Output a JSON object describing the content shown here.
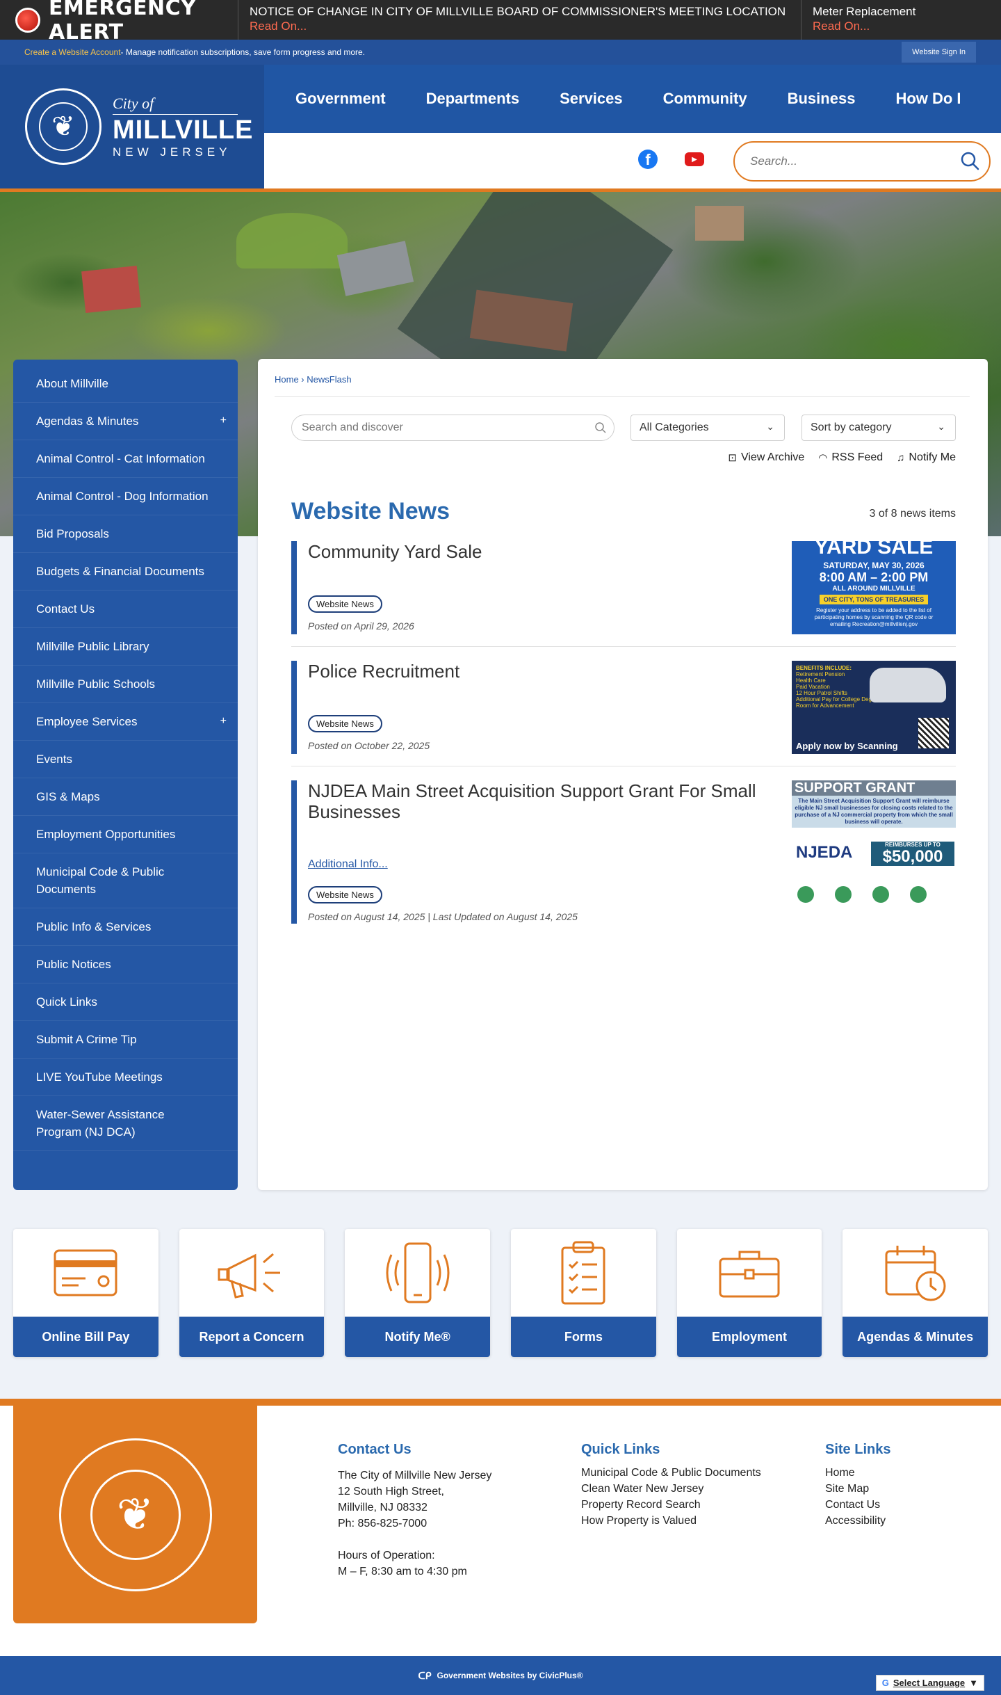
{
  "alert": {
    "title": "EMERGENCY ALERT",
    "items": [
      {
        "headline": "NOTICE OF CHANGE IN CITY OF MILLVILLE BOARD OF COMMISSIONER'S MEETING LOCATION",
        "link": "Read On..."
      },
      {
        "headline": "Meter Replacement",
        "link": "Read On..."
      }
    ]
  },
  "account": {
    "create_link": "Create a Website Account",
    "text": " - Manage notification subscriptions, save form progress and more.",
    "signin": "Website Sign In"
  },
  "logo": {
    "city_of": "City of",
    "name": "MILLVILLE",
    "state": "NEW JERSEY"
  },
  "nav": [
    "Government",
    "Departments",
    "Services",
    "Community",
    "Business",
    "How Do I"
  ],
  "header_search": {
    "placeholder": "Search..."
  },
  "sidebar": [
    {
      "label": "About Millville",
      "expand": ""
    },
    {
      "label": "Agendas & Minutes",
      "expand": "+"
    },
    {
      "label": "Animal Control - Cat Information",
      "expand": ""
    },
    {
      "label": "Animal Control - Dog Information",
      "expand": ""
    },
    {
      "label": "Bid Proposals",
      "expand": ""
    },
    {
      "label": "Budgets & Financial Documents",
      "expand": ""
    },
    {
      "label": "Contact Us",
      "expand": ""
    },
    {
      "label": "Millville Public Library",
      "expand": ""
    },
    {
      "label": "Millville Public Schools",
      "expand": ""
    },
    {
      "label": "Employee Services",
      "expand": "+"
    },
    {
      "label": "Events",
      "expand": ""
    },
    {
      "label": "GIS & Maps",
      "expand": ""
    },
    {
      "label": "Employment Opportunities",
      "expand": ""
    },
    {
      "label": "Municipal Code & Public Documents",
      "expand": ""
    },
    {
      "label": "Public Info & Services",
      "expand": ""
    },
    {
      "label": "Public Notices",
      "expand": ""
    },
    {
      "label": "Quick Links",
      "expand": ""
    },
    {
      "label": "Submit A Crime Tip",
      "expand": ""
    },
    {
      "label": "LIVE YouTube Meetings",
      "expand": ""
    },
    {
      "label": "Water-Sewer Assistance Program (NJ DCA)",
      "expand": ""
    }
  ],
  "breadcrumb": {
    "home": "Home",
    "sep": " › ",
    "current": "NewsFlash"
  },
  "filters": {
    "search_placeholder": "Search and discover",
    "category": "All Categories",
    "sort": "Sort by category",
    "chevron": "⌄"
  },
  "tools": {
    "archive": "View Archive",
    "rss": "RSS Feed",
    "notify": "Notify Me"
  },
  "news": {
    "heading": "Website News",
    "count": "3 of 8 news items",
    "items": [
      {
        "title": "Community Yard Sale",
        "tag": "Website News",
        "posted": "Posted on April 29, 2026",
        "more": ""
      },
      {
        "title": "Police Recruitment",
        "tag": "Website News",
        "posted": "Posted on October 22, 2025",
        "more": ""
      },
      {
        "title": "NJDEA Main Street Acquisition Support Grant For Small Businesses",
        "tag": "Website News",
        "posted": "Posted on August 14, 2025 | Last Updated on August 14, 2025",
        "more": "Additional Info..."
      }
    ],
    "thumb_yard": {
      "big": "YARD SALE",
      "date": "SATURDAY, MAY 30, 2026",
      "time": "8:00 AM – 2:00 PM",
      "where": "ALL AROUND MILLVILLE",
      "banner": "ONE CITY, TONS OF TREASURES",
      "note": "Register your address to be added to the list of participating homes by scanning the QR code or emailing Recreation@millvillenj.gov"
    },
    "thumb_police": {
      "head": "BENEFITS INCLUDE:",
      "lines": [
        "Retirement Pension",
        "Health Care",
        "Paid Vacation",
        "12 Hour Patrol Shifts",
        "Additional Pay for College Degrees",
        "Room for Advancement"
      ],
      "apply": "Apply now by Scanning"
    },
    "thumb_grant": {
      "head": "SUPPORT GRANT",
      "desc": "The Main Street Acquisition Support Grant will reimburse eligible NJ small businesses for closing costs related to the purchase of a NJ commercial property from which the small business will operate.",
      "logo": "NJEDA",
      "reimb_label": "REIMBURSES UP TO",
      "reimb_amount": "$50,000"
    }
  },
  "tiles": [
    {
      "label": "Online Bill Pay",
      "icon": "credit-card-icon"
    },
    {
      "label": "Report a Concern",
      "icon": "megaphone-icon"
    },
    {
      "label": "Notify Me®",
      "icon": "phone-notify-icon"
    },
    {
      "label": "Forms",
      "icon": "clipboard-icon"
    },
    {
      "label": "Employment",
      "icon": "briefcase-icon"
    },
    {
      "label": "Agendas & Minutes",
      "icon": "calendar-clock-icon"
    }
  ],
  "footer": {
    "contact": {
      "heading": "Contact Us",
      "lines": [
        "The City of Millville New Jersey",
        "12 South High Street,",
        "Millville, NJ 08332",
        "Ph: 856-825-7000",
        "",
        "Hours of Operation:",
        "M – F, 8:30 am to 4:30 pm"
      ]
    },
    "quick": {
      "heading": "Quick Links",
      "links": [
        "Municipal Code & Public Documents",
        "Clean Water New Jersey",
        "Property Record Search",
        "How Property is Valued"
      ]
    },
    "site": {
      "heading": "Site Links",
      "links": [
        "Home",
        "Site Map",
        "Contact Us",
        "Accessibility"
      ]
    }
  },
  "bottom": {
    "credit": "Government Websites by CivicPlus®",
    "language": "Select Language"
  },
  "colors": {
    "brand_blue": "#2457a5",
    "accent_orange": "#e07a21",
    "alert_dark": "#2a2a2a",
    "heading_blue": "#2a69ae"
  }
}
